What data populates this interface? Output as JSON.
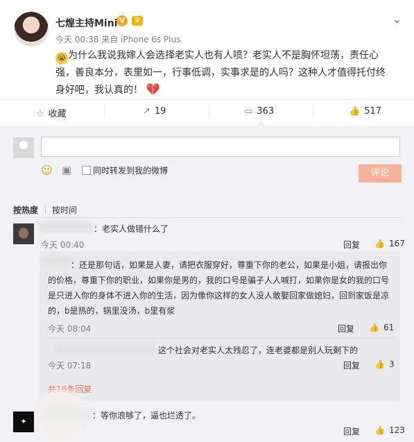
{
  "post": {
    "username": "七煌主持Mini",
    "meta": "今天 00:38 来自 iPhone 6s Plus",
    "text": "为什么我说我嫁人会选择老实人也有人喷？老实人不是胸怀坦荡，责任心强，善良本分，表里如一，行事低调，实事求是的人吗？这种人才值得托付终身好吧，我认真的！"
  },
  "actions": {
    "favorite": "收藏",
    "repost_count": "19",
    "comment_count": "363",
    "like_count": "517"
  },
  "composer": {
    "sync_label": "同时转发到我的微博",
    "submit_label": "评论"
  },
  "sort": {
    "hot": "按热度",
    "time": "按时间"
  },
  "comments": [
    {
      "text": "：老实人做错什么了",
      "time": "今天 00:40",
      "reply": "回复",
      "likes": "167"
    },
    {
      "text": "：等你浪够了，逼也烂透了。",
      "time": "",
      "reply": "回复",
      "likes": "123"
    }
  ],
  "replies": [
    {
      "text": "：还是那句话，如果是人妻，请把衣服穿好，尊重下你的老公，如果是小姐，请报出你的价格，尊重下你的职业，如果你是男的，我的口号是骗子人人喊打，如果你是女的我的口号是只进入你的身体不进入你的生活，因为像你这样的女人没人敢娶回家做媳妇，回到家饭是凉的，b是热的，锅里没汤，b里有浆",
      "time": "今天 08:04",
      "reply": "回复",
      "likes": "61"
    },
    {
      "text": "这个社会对老实人太残忍了，连老婆都是别人玩剩下的",
      "time": "今天 07:18",
      "reply": "回复",
      "likes": "3"
    }
  ],
  "more_replies": "共16条回复",
  "icons": {
    "verified": "V",
    "crown": "crown-icon",
    "chevron": "chevron-down-icon",
    "favorite": "star-icon",
    "repost": "share-icon",
    "comment": "comment-icon",
    "like": "thumbs-up-icon"
  }
}
